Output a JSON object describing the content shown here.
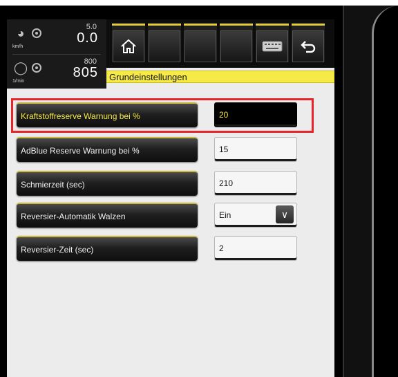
{
  "gauges": {
    "speed": {
      "icon": "speedometer-icon",
      "unit": "km/h",
      "limit": "5.0",
      "value": "0.0"
    },
    "rpm": {
      "icon": "engine-icon",
      "unit": "1/min",
      "limit": "800",
      "value": "805"
    }
  },
  "toolbar": {
    "tabs": [
      {
        "icon": "home-icon"
      },
      {
        "icon": ""
      },
      {
        "icon": ""
      },
      {
        "icon": ""
      },
      {
        "icon": "keyboard-icon"
      },
      {
        "icon": "back-icon"
      }
    ]
  },
  "title": "Grundeinstellungen",
  "settings": [
    {
      "label": "Kraftstoffreserve Warnung bei %",
      "value": "20",
      "active": true
    },
    {
      "label": "AdBlue Reserve Warnung bei %",
      "value": "15",
      "active": false
    },
    {
      "label": "Schmierzeit (sec)",
      "value": "210",
      "active": false
    },
    {
      "label": "Reversier-Automatik Walzen",
      "value": "Ein",
      "active": false,
      "type": "select"
    },
    {
      "label": "Reversier-Zeit (sec)",
      "value": "2",
      "active": false
    }
  ],
  "colors": {
    "accent": "#f6ea47",
    "highlight": "#e8242b"
  }
}
